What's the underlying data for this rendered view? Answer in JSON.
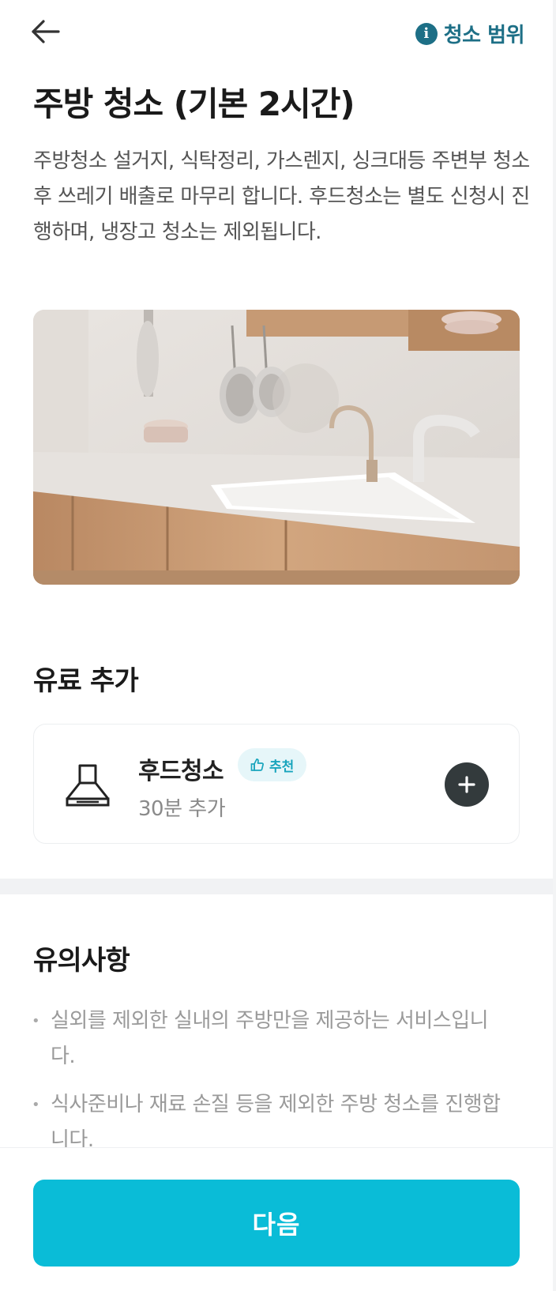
{
  "header": {
    "scope_label": "청소 범위",
    "info_glyph": "i",
    "back_icon": "arrow-left-icon"
  },
  "main": {
    "title": "주방 청소 (기본 2시간)",
    "description": "주방청소 설거지, 식탁정리, 가스렌지, 싱크대등 주변부 청소 후 쓰레기 배출로 마무리 합니다. 후드청소는 별도 신청시 진행하며, 냉장고 청소는 제외됩니다."
  },
  "paid_addons": {
    "section_title": "유료 추가",
    "items": [
      {
        "name": "후드청소",
        "badge": "추천",
        "time": "30분 추가",
        "icon": "range-hood-icon"
      }
    ]
  },
  "notes": {
    "section_title": "유의사항",
    "items": [
      "실외를 제외한 실내의 주방만을 제공하는 서비스입니다.",
      "식사준비나 재료 손질 등을 제외한 주방 청소를 진행합니다."
    ]
  },
  "footer": {
    "next_label": "다음"
  },
  "colors": {
    "accent": "#0abcd7",
    "info": "#1d6f86",
    "badge_bg": "#e6f6f9",
    "add_button": "#333a3c"
  }
}
